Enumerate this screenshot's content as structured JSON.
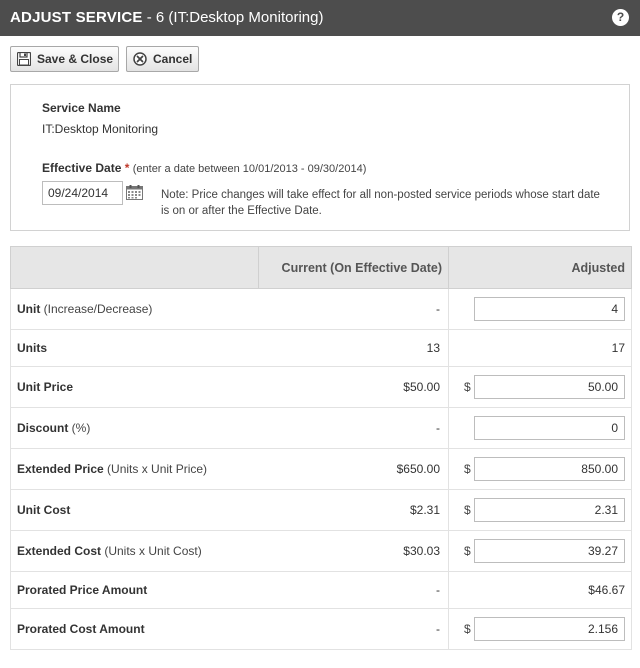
{
  "window": {
    "title_bold": "ADJUST SERVICE",
    "title_rest": " - 6 (IT:Desktop Monitoring)"
  },
  "toolbar": {
    "save_label": "Save & Close",
    "cancel_label": "Cancel"
  },
  "service": {
    "name_label": "Service Name",
    "name_value": "IT:Desktop Monitoring"
  },
  "effective_date": {
    "label": "Effective Date",
    "required_mark": "*",
    "hint": "(enter a date between 10/01/2013 - 09/30/2014)",
    "value": "09/24/2014",
    "note": "Note: Price changes will take effect for all non-posted service periods whose start date is on or after the Effective Date."
  },
  "table": {
    "headers": [
      "",
      "Current (On Effective Date)",
      "Adjusted"
    ],
    "rows": [
      {
        "label": "Unit",
        "sub": " (Increase/Decrease)",
        "current": "-",
        "adjusted": "4",
        "input": true,
        "dollar": false
      },
      {
        "label": "Units",
        "sub": "",
        "current": "13",
        "adjusted": "17",
        "input": false,
        "dollar": false
      },
      {
        "label": "Unit Price",
        "sub": "",
        "current": "$50.00",
        "adjusted": "50.00",
        "input": true,
        "dollar": true
      },
      {
        "label": "Discount",
        "sub": " (%)",
        "current": "-",
        "adjusted": "0",
        "input": true,
        "dollar": false
      },
      {
        "label": "Extended Price",
        "sub": " (Units x Unit Price)",
        "current": "$650.00",
        "adjusted": "850.00",
        "input": true,
        "dollar": true
      },
      {
        "label": "Unit Cost",
        "sub": "",
        "current": "$2.31",
        "adjusted": "2.31",
        "input": true,
        "dollar": true
      },
      {
        "label": "Extended Cost",
        "sub": " (Units x Unit Cost)",
        "current": "$30.03",
        "adjusted": "39.27",
        "input": true,
        "dollar": true
      },
      {
        "label": "Prorated Price Amount",
        "sub": "",
        "current": "-",
        "adjusted": "$46.67",
        "input": false,
        "dollar": false
      },
      {
        "label": "Prorated Cost Amount",
        "sub": "",
        "current": "-",
        "adjusted": "2.156",
        "input": true,
        "dollar": true
      }
    ]
  },
  "currency_symbol": "$",
  "colors": {
    "titlebar": "#4d4d4d",
    "header_bg": "#e6e6e6",
    "required": "#c0392b"
  },
  "icons": {
    "help": "question-circle-icon",
    "save": "floppy-disk-icon",
    "cancel": "cancel-circle-icon",
    "calendar": "calendar-icon"
  }
}
